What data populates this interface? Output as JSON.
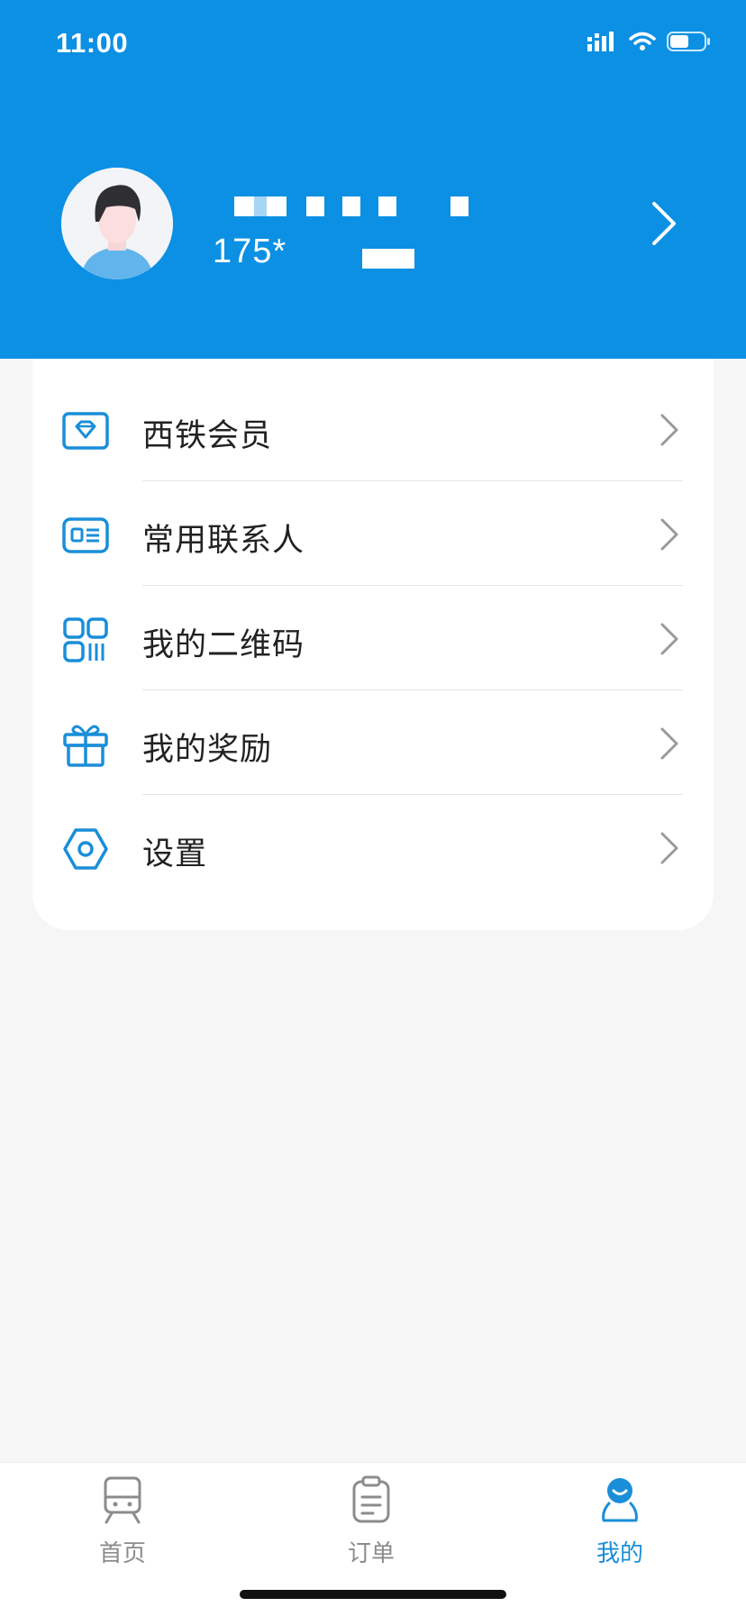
{
  "status_bar": {
    "time": "11:00",
    "signal_icon": "cellular-signal-icon",
    "wifi_icon": "wifi-icon",
    "battery_icon": "battery-icon"
  },
  "profile": {
    "phone": "175*",
    "avatar_icon": "user-avatar-icon",
    "chevron_icon": "chevron-right-icon"
  },
  "menu": {
    "items": [
      {
        "label": "西铁会员",
        "icon": "diamond-card-icon"
      },
      {
        "label": "常用联系人",
        "icon": "id-card-icon"
      },
      {
        "label": "我的二维码",
        "icon": "qr-code-icon"
      },
      {
        "label": "我的奖励",
        "icon": "gift-icon"
      },
      {
        "label": "设置",
        "icon": "settings-icon"
      }
    ]
  },
  "tabbar": {
    "tabs": [
      {
        "label": "首页",
        "icon": "train-icon",
        "active": false
      },
      {
        "label": "订单",
        "icon": "clipboard-icon",
        "active": false
      },
      {
        "label": "我的",
        "icon": "person-icon",
        "active": true
      }
    ]
  },
  "colors": {
    "header_bg": "#0b90e3",
    "accent": "#1a8ed8",
    "page_bg": "#f6f6f6"
  }
}
